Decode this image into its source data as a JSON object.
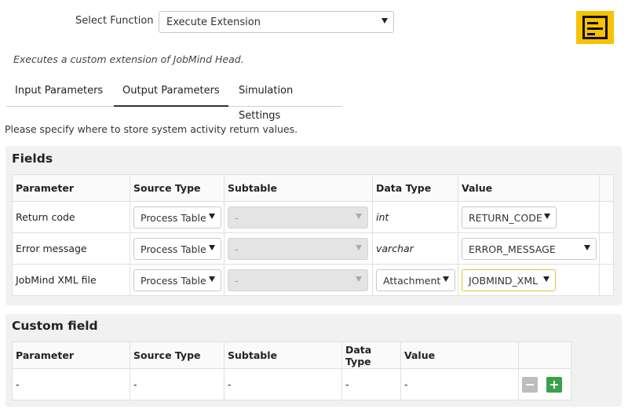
{
  "header": {
    "select_function_label": "Select Function",
    "function_value": "Execute Extension",
    "description": "Executes a custom extension of JobMind Head."
  },
  "tabs": [
    {
      "label": "Input Parameters",
      "active": false
    },
    {
      "label": "Output Parameters",
      "active": true
    },
    {
      "label": "Simulation Settings",
      "active": false
    }
  ],
  "instructions": "Please specify where to store system activity return values.",
  "fields": {
    "title": "Fields",
    "columns": [
      "Parameter",
      "Source Type",
      "Subtable",
      "Data Type",
      "Value"
    ],
    "rows": [
      {
        "parameter": "Return code",
        "source_type": "Process Table",
        "subtable": "-",
        "data_type": "int",
        "value": "RETURN_CODE"
      },
      {
        "parameter": "Error message",
        "source_type": "Process Table",
        "subtable": "-",
        "data_type": "varchar",
        "value": "ERROR_MESSAGE"
      },
      {
        "parameter": "JobMind XML file",
        "source_type": "Process Table",
        "subtable": "-",
        "data_type": "Attachment",
        "value": "JOBMIND_XML"
      }
    ]
  },
  "custom_field": {
    "title": "Custom field",
    "columns": [
      "Parameter",
      "Source Type",
      "Subtable",
      "Data Type",
      "Value"
    ],
    "row": {
      "parameter": "-",
      "source_type": "-",
      "subtable": "-",
      "data_type": "-",
      "value": "-"
    }
  },
  "colors": {
    "accent_logo": "#f7c300",
    "add_button": "#3aa14a",
    "remove_button": "#bdbdbd"
  },
  "icons": {
    "logo": "document-lines-icon",
    "remove": "minus-icon",
    "add": "plus-icon",
    "dropdown": "chevron-down-icon"
  }
}
